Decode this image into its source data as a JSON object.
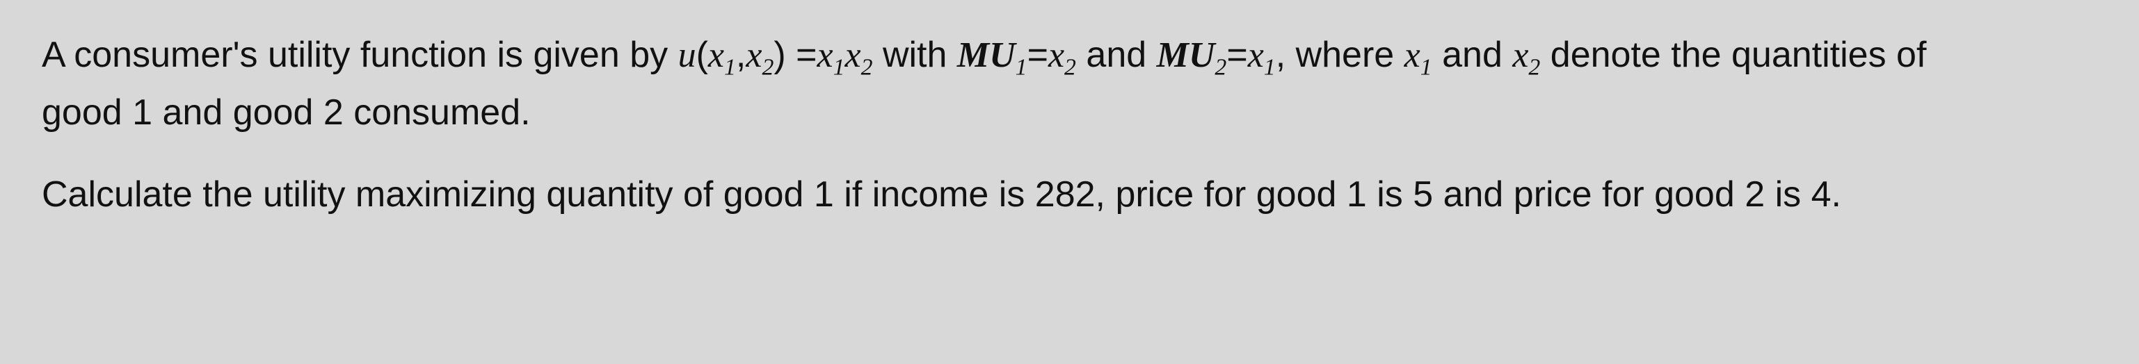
{
  "paragraph1": {
    "text_intro": "A consumer's utility function is given by ",
    "math_u": "u",
    "paren_open": "(",
    "math_x1": "x",
    "sub1": "1",
    "comma": ",",
    "math_x2": "x",
    "sub2": "2",
    "paren_close": ")",
    "equals1": "=",
    "math_x1b": "x",
    "sub1b": "1",
    "math_x2b": "x",
    "sub2b": "2",
    "text_with": " with ",
    "math_MU1": "MU",
    "sub_mu1": "1",
    "equals2": "=",
    "math_x2c": "x",
    "sub2c": "2",
    "text_and1": " and ",
    "math_MU2": "MU",
    "sub_mu2": "2",
    "equals3": "=",
    "math_x1c": "x",
    "sub1c": "1",
    "text_where": ", where ",
    "math_x1d": "x",
    "sub1d": "1",
    "text_and2": " and ",
    "math_x2d": "x",
    "sub2d": "2",
    "text_denote": " denote the quantities of"
  },
  "paragraph1_line2": {
    "text": "good 1 and good 2 consumed."
  },
  "paragraph2": {
    "text": "Calculate the utility maximizing quantity of good 1 if income is 282, price for good 1 is 5 and price for good 2 is 4."
  }
}
